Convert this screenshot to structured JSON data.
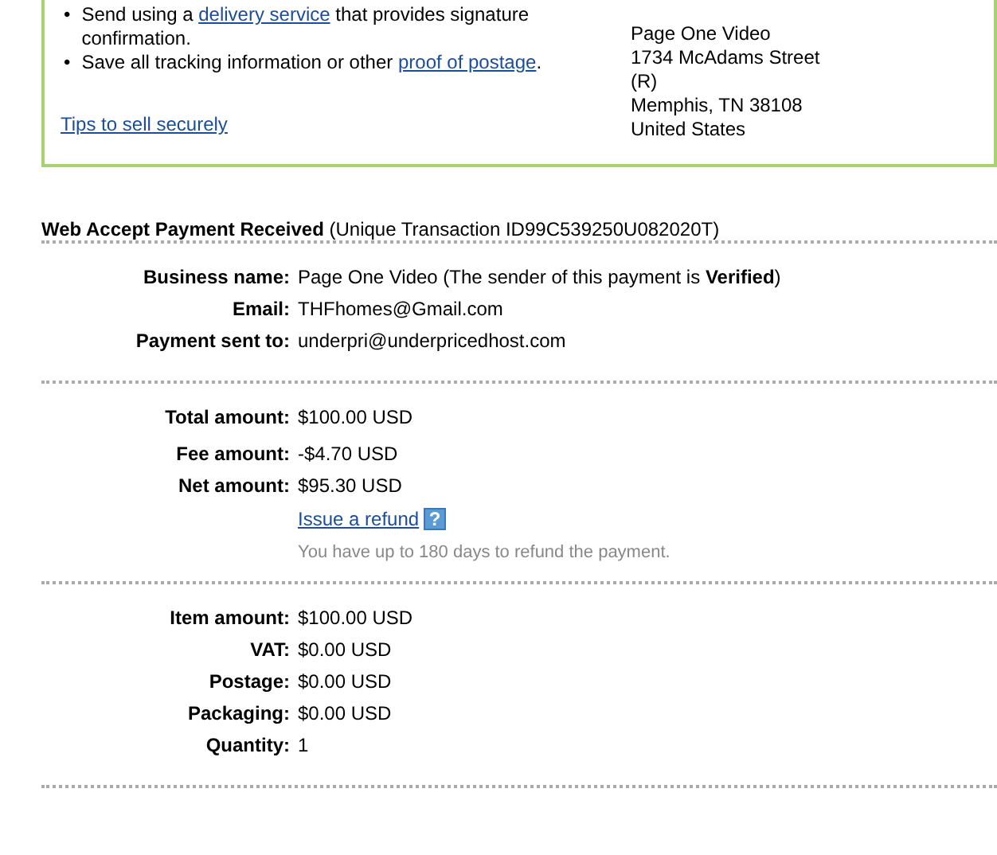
{
  "shipping_box": {
    "tips": [
      {
        "bullet": "•",
        "before": "Send using a ",
        "link": "delivery service",
        "after": " that provides signature confirmation."
      },
      {
        "bullet": "•",
        "before": "Save all tracking information or other ",
        "link": "proof of postage",
        "after": "."
      }
    ],
    "secure_link": "Tips to sell securely",
    "address": [
      "Page One Video",
      "1734 McAdams Street",
      "(R)",
      "Memphis, TN 38108",
      "United States"
    ]
  },
  "heading": {
    "title": "Web Accept Payment Received",
    "detail": "(Unique Transaction ID99C539250U082020T)"
  },
  "sections": [
    {
      "rows": [
        {
          "label": "Business name:",
          "value": "Page One Video (The sender of this payment is **Verified**)"
        },
        {
          "label": "Email:",
          "value": "THFhomes@Gmail.com"
        },
        {
          "label": "Payment sent to:",
          "value": "underpri@underpricedhost.com"
        }
      ]
    },
    {
      "rows": [
        {
          "label": "Total amount:",
          "value": "$100.00 USD"
        },
        {
          "label": "Fee amount:",
          "value": "-$4.70 USD"
        },
        {
          "label": "Net amount:",
          "value": "$95.30 USD"
        }
      ],
      "refund": {
        "link": "Issue a refund",
        "help": "?",
        "note": "You have up to 180 days to refund the payment."
      }
    },
    {
      "rows": [
        {
          "label": "Item amount:",
          "value": "$100.00 USD"
        },
        {
          "label": "VAT:",
          "value": "$0.00 USD"
        },
        {
          "label": "Postage:",
          "value": "$0.00 USD"
        },
        {
          "label": "Packaging:",
          "value": "$0.00 USD"
        },
        {
          "label": "Quantity:",
          "value": "1"
        }
      ]
    }
  ]
}
